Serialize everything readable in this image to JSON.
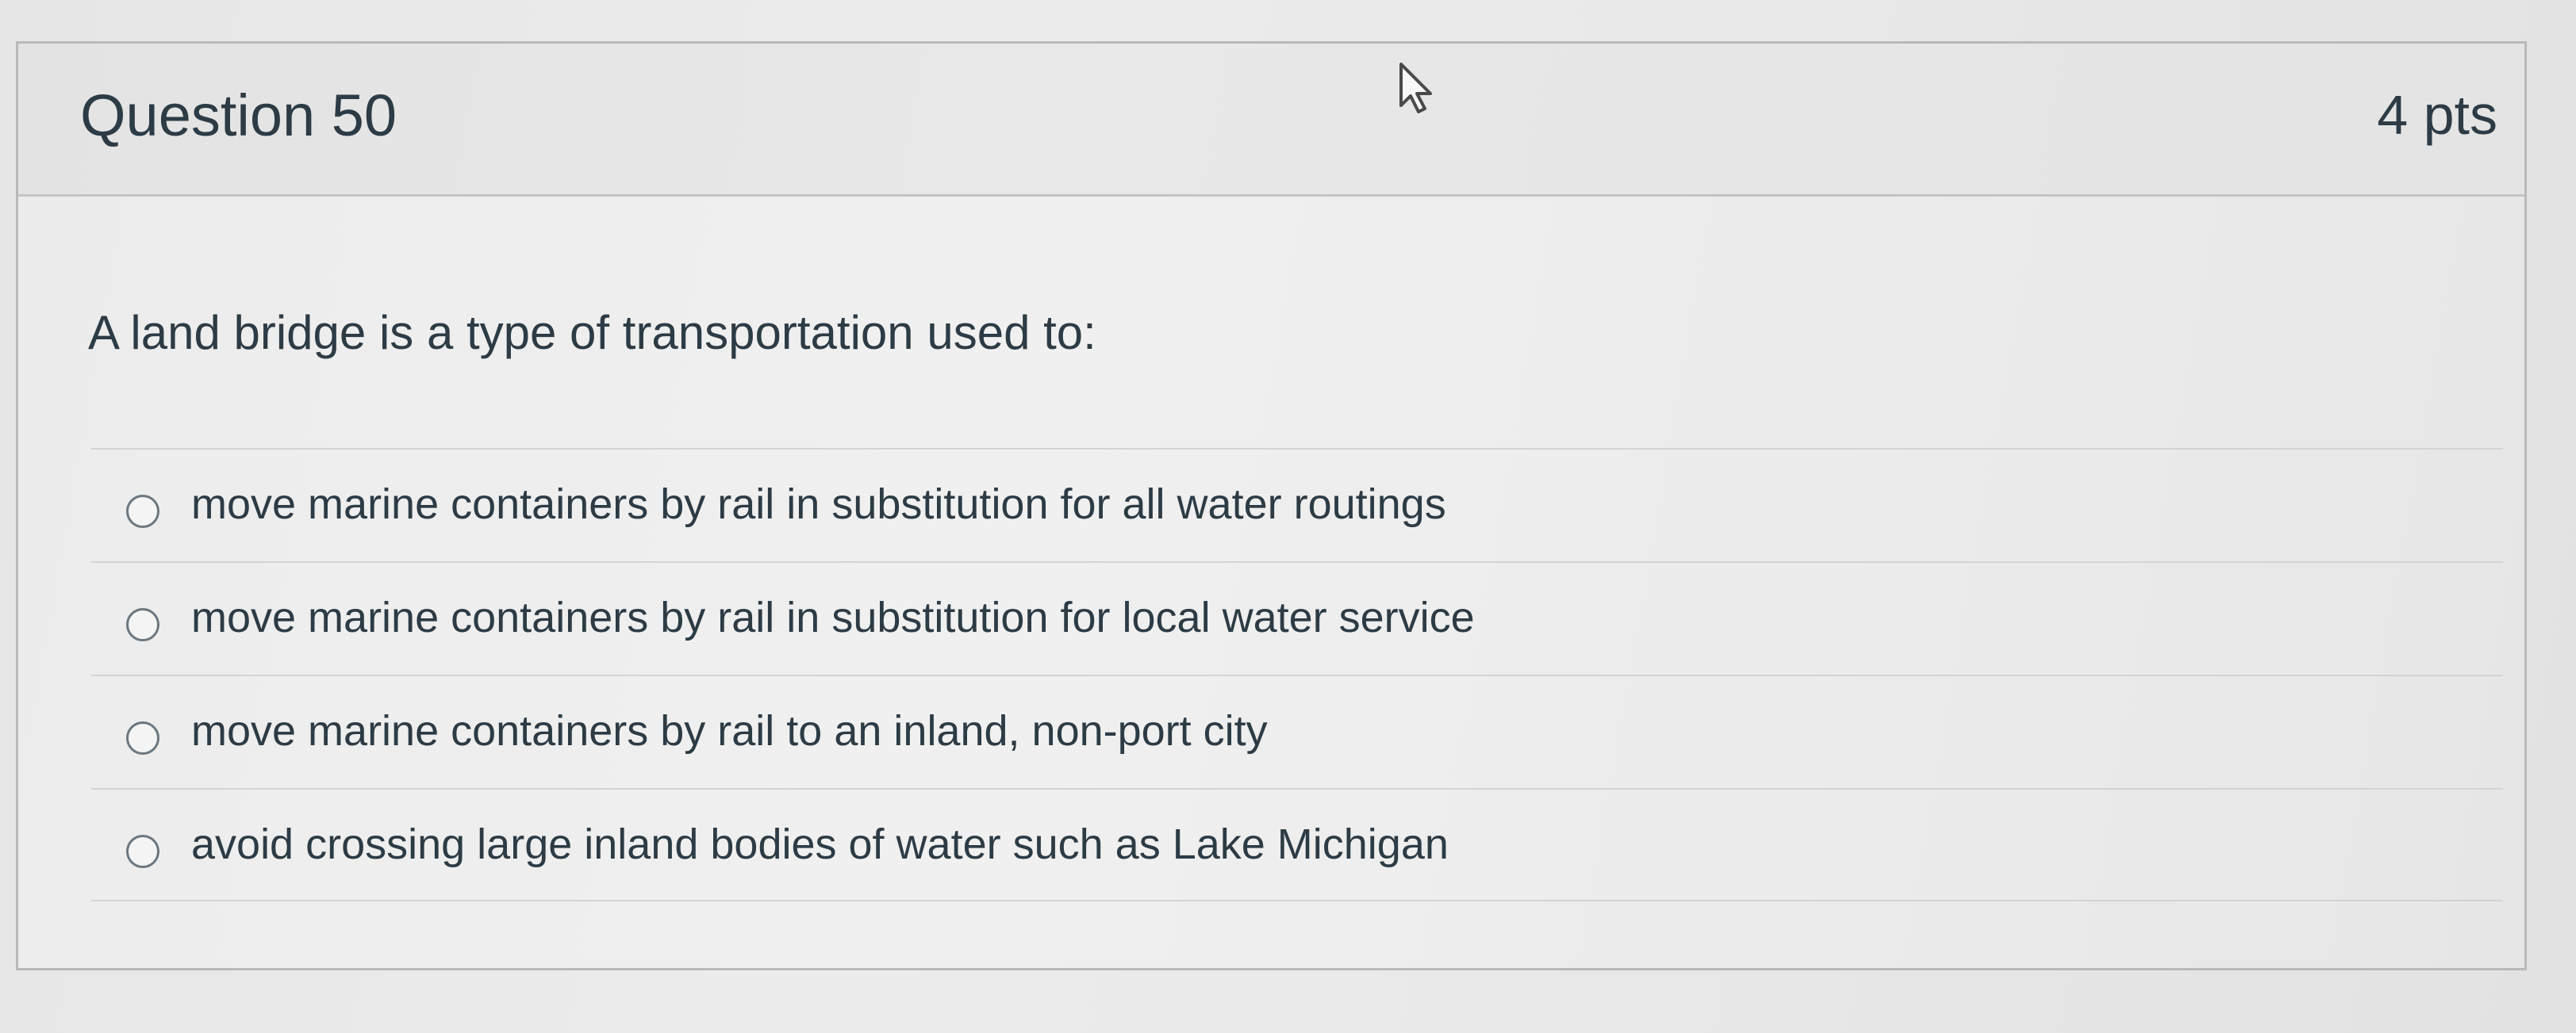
{
  "question": {
    "title": "Question 50",
    "points": "4 pts",
    "prompt": "A land bridge is a type of transportation used to:",
    "options": [
      {
        "label": "move marine containers by rail in substitution for all water routings",
        "selected": false
      },
      {
        "label": "move marine containers by rail in substitution for local water service",
        "selected": false
      },
      {
        "label": "move marine containers by rail to an inland, non-port city",
        "selected": false
      },
      {
        "label": "avoid crossing large inland bodies of water such as Lake Michigan",
        "selected": false
      }
    ]
  },
  "icons": {
    "cursor": "mouse-pointer-icon",
    "radio": "radio-button-unselected"
  },
  "colors": {
    "text": "#2d3b45",
    "border": "#b9b9b9",
    "header_background": "#e6e6e6"
  }
}
